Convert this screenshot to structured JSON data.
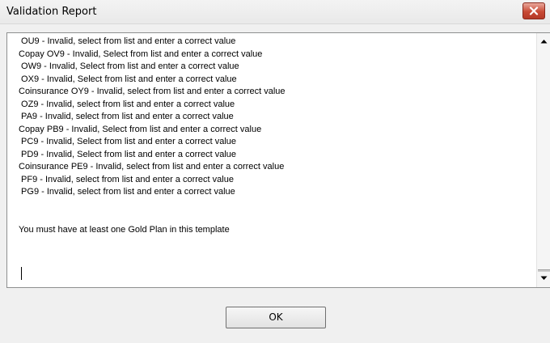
{
  "window": {
    "title": "Validation Report",
    "close_icon": "close-x-icon",
    "close_color": "#c84a35"
  },
  "report": {
    "lines": [
      " OU9 - Invalid, select from list and enter a correct value",
      "Copay OV9 - Invalid, Select from list and enter a correct value",
      " OW9 - Invalid, Select from list and enter a correct value",
      " OX9 - Invalid, Select from list and enter a correct value",
      "Coinsurance OY9 - Invalid, select from list and enter a correct value",
      " OZ9 - Invalid, select from list and enter a correct value",
      " PA9 - Invalid, select from list and enter a correct value",
      "Copay PB9 - Invalid, Select from list and enter a correct value",
      " PC9 - Invalid, Select from list and enter a correct value",
      " PD9 - Invalid, Select from list and enter a correct value",
      "Coinsurance PE9 - Invalid, select from list and enter a correct value",
      " PF9 - Invalid, select from list and enter a correct value",
      " PG9 - Invalid, select from list and enter a correct value",
      "",
      "",
      "You must have at least one Gold Plan in this template"
    ]
  },
  "scrollbar": {
    "up_icon": "scroll-up-arrow-icon",
    "down_icon": "scroll-down-arrow-icon"
  },
  "buttons": {
    "ok_label": "OK"
  }
}
